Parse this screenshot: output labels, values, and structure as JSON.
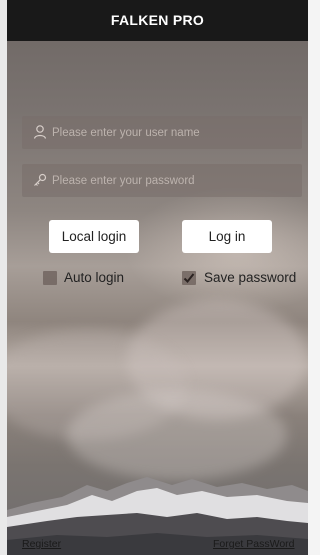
{
  "header": {
    "title": "FALKEN PRO"
  },
  "form": {
    "username_placeholder": "Please enter your user name",
    "password_placeholder": "Please enter your password",
    "local_login_label": "Local login",
    "login_label": "Log in",
    "auto_login_label": "Auto login",
    "auto_login_checked": false,
    "save_password_label": "Save password",
    "save_password_checked": true
  },
  "footer": {
    "register_label": "Register",
    "forget_password_label": "Forget PassWord"
  },
  "icons": {
    "username": "user-icon",
    "password": "key-icon",
    "checkmark": "checkmark-icon"
  },
  "colors": {
    "header_bg": "#191919",
    "button_bg": "#ffffff",
    "field_bg": "rgba(120,110,105,0.55)"
  }
}
